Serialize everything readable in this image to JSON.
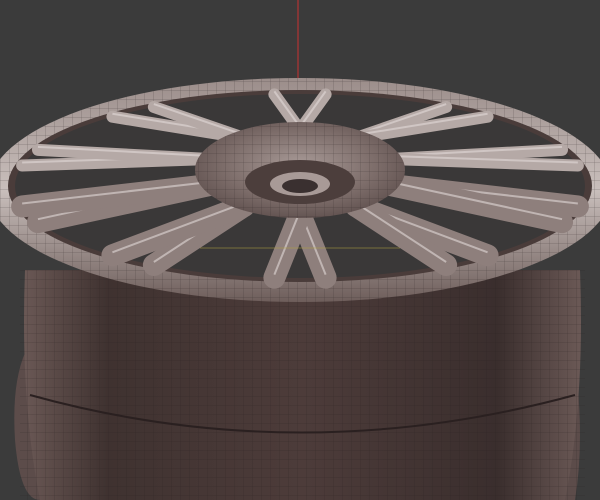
{
  "viewport": {
    "subject": "wheel-rim-wireframe-model",
    "colors": {
      "background": "#3b3b3b",
      "rim_metal": "#8a7a78",
      "rim_highlight": "#d8d0ce",
      "barrel": "#4a3b39",
      "wire": "#2a2222",
      "z_axis": "#c83030",
      "x_axis": "#b0a040"
    },
    "spoke_count": 10
  }
}
